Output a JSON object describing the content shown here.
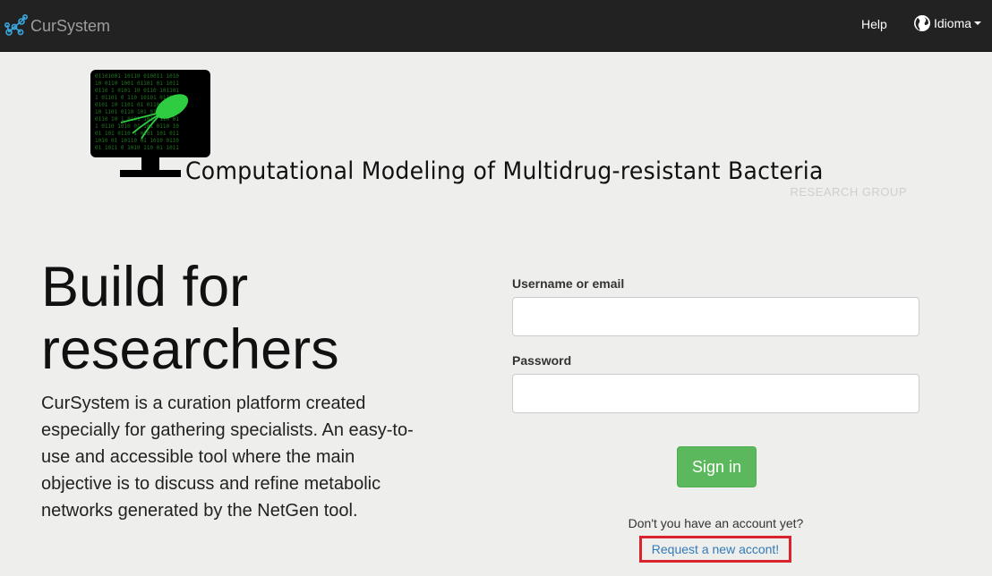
{
  "navbar": {
    "brand": "CurSystem",
    "brand_icon": "network-nodes-icon",
    "help": "Help",
    "language": "Idioma",
    "language_icon": "globe-icon",
    "background": "#222222",
    "brand_accent": "#3aa7e0"
  },
  "banner": {
    "title": "Computational Modeling of Multidrug-resistant Bacteria",
    "subtitle": "RESEARCH GROUP",
    "logo_icon": "monitor-bacteria-icon"
  },
  "hero": {
    "title": "Build for researchers",
    "description": "CurSystem is a curation platform created especially for gathering specialists. An easy-to-use and accessible tool where the main objective is to discuss and refine metabolic networks generated by the NetGen tool."
  },
  "login": {
    "username_label": "Username or email",
    "username_value": "",
    "password_label": "Password",
    "password_value": "",
    "signin": "Sign in",
    "no_account": "Don't you have an account yet?",
    "request_link": "Request a new accont!",
    "signin_color": "#5cb85c",
    "link_color": "#337ab7",
    "highlight_color": "#d9232d"
  }
}
